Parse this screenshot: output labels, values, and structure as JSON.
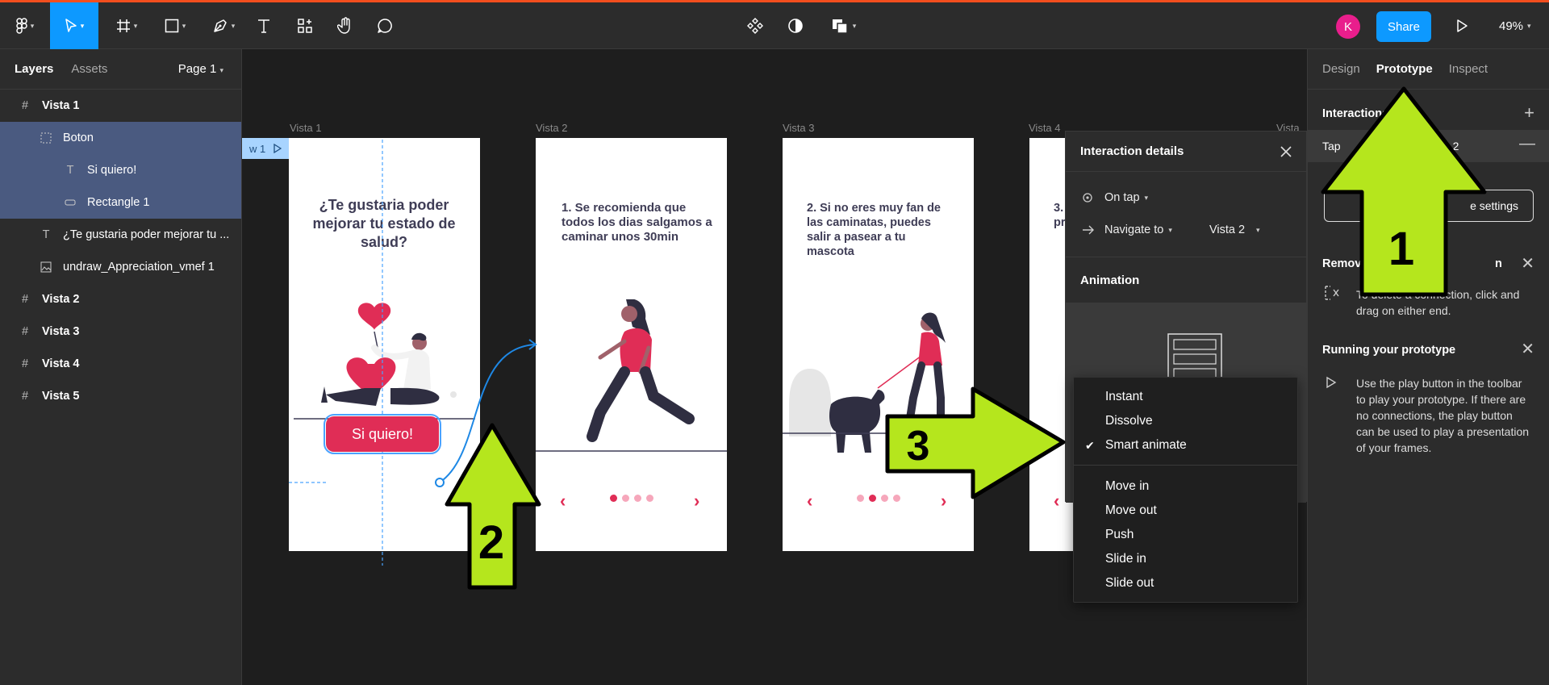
{
  "toolbar": {
    "avatar_initial": "K",
    "share_label": "Share",
    "zoom_label": "49%"
  },
  "left_panel": {
    "tabs": [
      "Layers",
      "Assets"
    ],
    "page": "Page 1",
    "layers": [
      {
        "name": "Vista 1"
      },
      {
        "name": "Boton"
      },
      {
        "name": "Si quiero!"
      },
      {
        "name": "Rectangle 1"
      },
      {
        "name": "¿Te gustaria poder mejorar tu ..."
      },
      {
        "name": "undraw_Appreciation_vmef 1"
      },
      {
        "name": "Vista 2"
      },
      {
        "name": "Vista 3"
      },
      {
        "name": "Vista 4"
      },
      {
        "name": "Vista 5"
      }
    ]
  },
  "canvas": {
    "flow_tag": "w 1",
    "frames": [
      {
        "label": "Vista 1",
        "text": "¿Te gustaria poder mejorar tu estado de salud?"
      },
      {
        "label": "Vista 2",
        "text": "1. Se recomienda que todos los dias salgamos a caminar unos 30min"
      },
      {
        "label": "Vista 3",
        "text": "2. Si no eres muy fan de las caminatas, puedes salir a pasear a tu mascota"
      },
      {
        "label": "Vista 4",
        "text": "3. ju pr"
      },
      {
        "label": "Vista"
      }
    ],
    "button_label": "Si quiero!"
  },
  "interaction_details": {
    "title": "Interaction details",
    "trigger": "On tap",
    "action": "Navigate to",
    "destination": "Vista 2",
    "animation_title": "Animation"
  },
  "dropdown": {
    "items": [
      "Instant",
      "Dissolve",
      "Smart animate",
      "Move in",
      "Move out",
      "Push",
      "Slide in",
      "Slide out"
    ],
    "selected": "Smart animate"
  },
  "right_panel": {
    "tabs": [
      "Design",
      "Prototype",
      "Inspect"
    ],
    "interactions_title": "Interactions",
    "interaction_trigger": "Tap",
    "interaction_dest": "a 2",
    "settings_label": "e settings",
    "removing_title": "Removi",
    "removing_title_end": "n",
    "removing_text": "To delete a connection, click and drag on either end.",
    "running_title": "Running your prototype",
    "running_text": "Use the play button in the toolbar to play your prototype. If there are no connections, the play button can be used to play a presentation of your frames."
  },
  "annotations": [
    "1",
    "2",
    "3"
  ],
  "colors": {
    "accent_blue": "#0d99ff",
    "brand_red": "#e02d56",
    "arrow_green": "#b5e61d",
    "selection": "#4a5a80"
  }
}
